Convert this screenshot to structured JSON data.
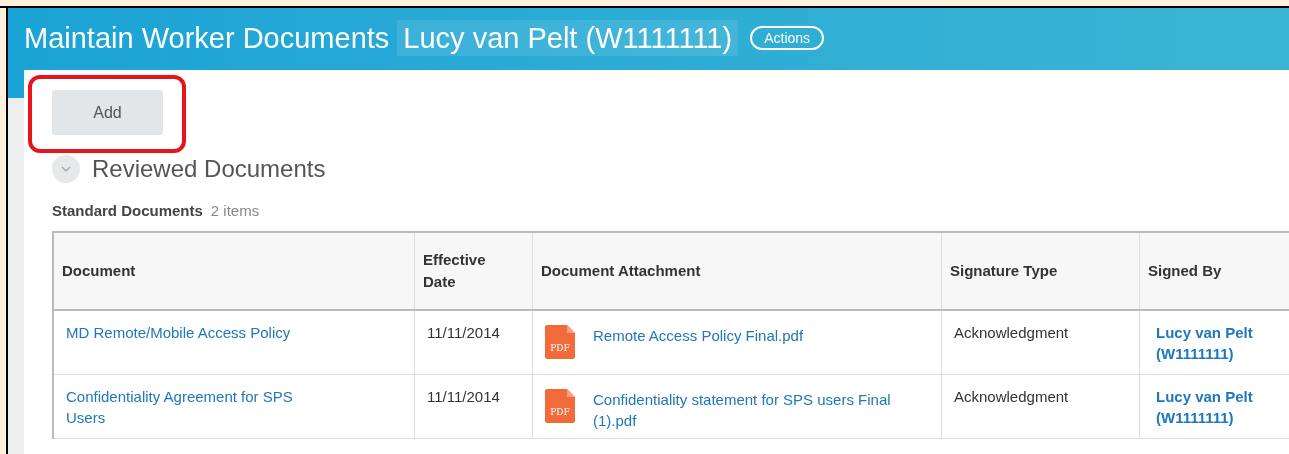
{
  "header": {
    "title": "Maintain Worker Documents",
    "worker": "Lucy van Pelt (W1111111)",
    "actions_button": "Actions"
  },
  "add_button": "Add",
  "section": {
    "title": "Reviewed Documents",
    "expanded": true
  },
  "grid": {
    "title": "Standard Documents",
    "count": "2 items",
    "columns": [
      "Document",
      "Effective Date",
      "Document Attachment",
      "Signature Type",
      "Signed By"
    ],
    "rows": [
      {
        "document": "MD Remote/Mobile Access Policy",
        "effective_date": "11/11/2014",
        "attachment_icon": "PDF",
        "attachment": "Remote Access Policy Final.pdf",
        "signature_type": "Acknowledgment",
        "signed_by": "Lucy van Pelt (W1111111)"
      },
      {
        "document": "Confidentiality Agreement for SPS Users",
        "effective_date": "11/11/2014",
        "attachment_icon": "PDF",
        "attachment": "Confidentiality statement for SPS users Final (1).pdf",
        "signature_type": "Acknowledgment",
        "signed_by": "Lucy van Pelt (W1111111)"
      }
    ]
  }
}
